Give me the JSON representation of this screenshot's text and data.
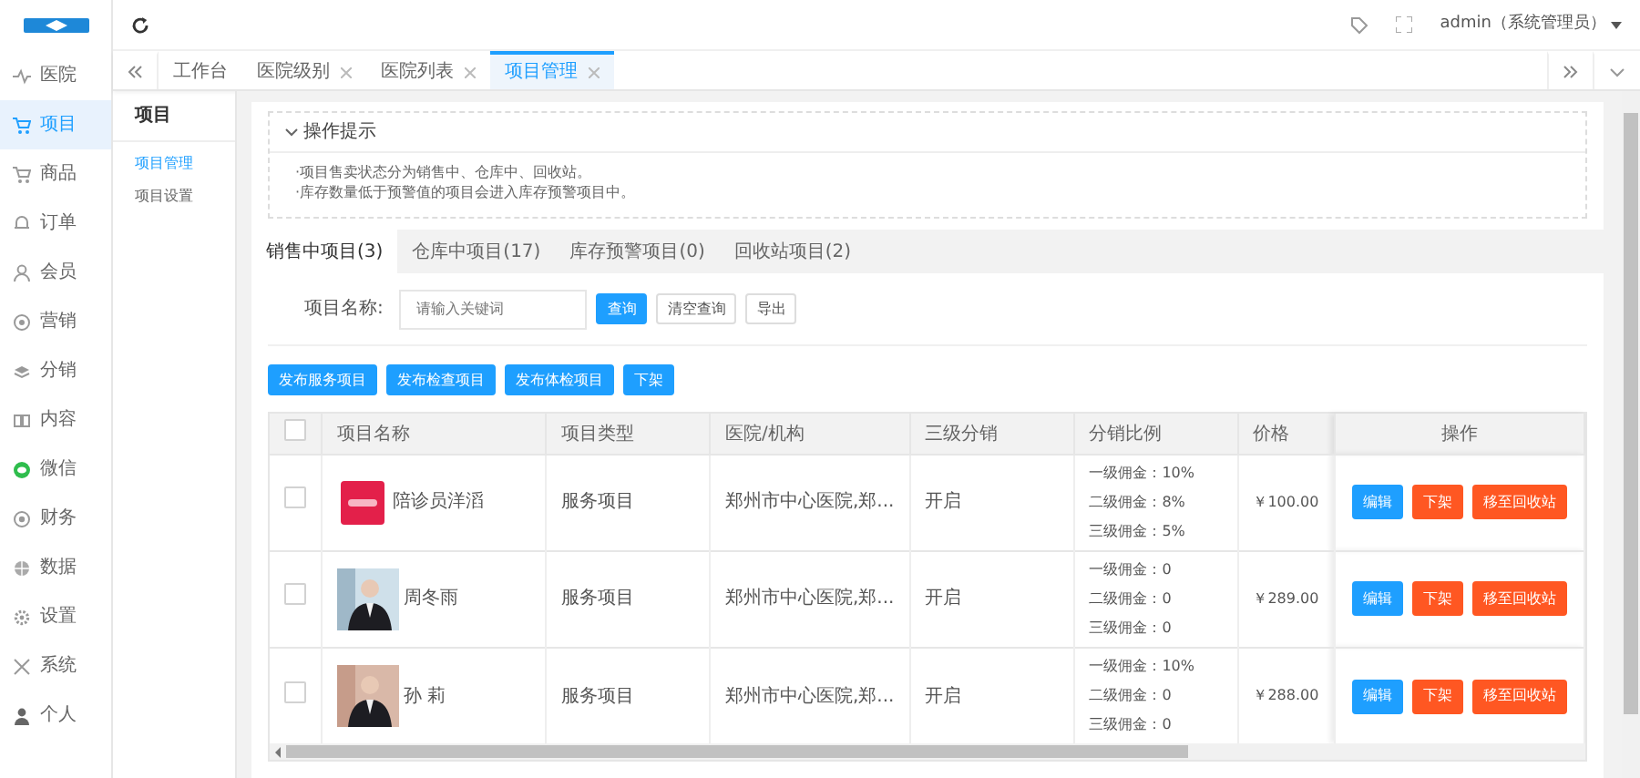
{
  "header": {
    "user": "admin（系统管理员）"
  },
  "sidebar": {
    "items": [
      {
        "label": "医院",
        "selected": false
      },
      {
        "label": "项目",
        "selected": true
      },
      {
        "label": "商品",
        "selected": false
      },
      {
        "label": "订单",
        "selected": false
      },
      {
        "label": "会员",
        "selected": false
      },
      {
        "label": "营销",
        "selected": false
      },
      {
        "label": "分销",
        "selected": false
      },
      {
        "label": "内容",
        "selected": false
      },
      {
        "label": "微信",
        "selected": false
      },
      {
        "label": "财务",
        "selected": false
      },
      {
        "label": "数据",
        "selected": false
      },
      {
        "label": "设置",
        "selected": false
      },
      {
        "label": "系统",
        "selected": false
      },
      {
        "label": "个人",
        "selected": false
      }
    ]
  },
  "page_tabs": [
    {
      "label": "工作台",
      "closable": false,
      "selected": false
    },
    {
      "label": "医院级别",
      "closable": true,
      "selected": false
    },
    {
      "label": "医院列表",
      "closable": true,
      "selected": false
    },
    {
      "label": "项目管理",
      "closable": true,
      "selected": true
    }
  ],
  "subnav": {
    "title": "项目",
    "items": [
      {
        "label": "项目管理",
        "selected": true
      },
      {
        "label": "项目设置",
        "selected": false
      }
    ]
  },
  "tips": {
    "title": "操作提示",
    "expanded": true,
    "lines": [
      "·项目售卖状态分为销售中、仓库中、回收站。",
      "·库存数量低于预警值的项目会进入库存预警项目中。"
    ]
  },
  "status_tabs": [
    {
      "label": "销售中项目(3)",
      "selected": true
    },
    {
      "label": "仓库中项目(17)",
      "selected": false
    },
    {
      "label": "库存预警项目(0)",
      "selected": false
    },
    {
      "label": "回收站项目(2)",
      "selected": false
    }
  ],
  "search": {
    "label": "项目名称:",
    "placeholder": "请输入关键词",
    "buttons": [
      {
        "label": "查询",
        "kind": "primary"
      },
      {
        "label": "清空查询",
        "kind": "plain"
      },
      {
        "label": "导出",
        "kind": "plain"
      }
    ]
  },
  "actions": [
    "发布服务项目",
    "发布检查项目",
    "发布体检项目",
    "下架"
  ],
  "table": {
    "select_all_checked": false,
    "columns": [
      "项目名称",
      "项目类型",
      "医院/机构",
      "三级分销",
      "分销比例",
      "价格",
      "操作"
    ],
    "rows": [
      {
        "checked": false,
        "thumb": {
          "kind": "picture"
        },
        "name": "陪诊员洋滔",
        "type": "服务项目",
        "hospital": "郑州市中心医院,郑...",
        "tier": "开启",
        "ratios": [
          "一级佣金：10%",
          "二级佣金：8%",
          "三级佣金：5%"
        ],
        "price": "￥100.00",
        "buttons": [
          {
            "label": "编辑",
            "kind": "primary"
          },
          {
            "label": "下架",
            "kind": "danger"
          },
          {
            "label": "移至回收站",
            "kind": "danger"
          }
        ]
      },
      {
        "checked": false,
        "thumb": {
          "kind": "picture"
        },
        "name": "周冬雨",
        "type": "服务项目",
        "hospital": "郑州市中心医院,郑...",
        "tier": "开启",
        "ratios": [
          "一级佣金：0",
          "二级佣金：0",
          "三级佣金：0"
        ],
        "price": "￥289.00",
        "buttons": [
          {
            "label": "编辑",
            "kind": "primary"
          },
          {
            "label": "下架",
            "kind": "danger"
          },
          {
            "label": "移至回收站",
            "kind": "danger"
          }
        ]
      },
      {
        "checked": false,
        "thumb": {
          "kind": "picture"
        },
        "name": "孙 莉",
        "type": "服务项目",
        "hospital": "郑州市中心医院,郑...",
        "tier": "开启",
        "ratios": [
          "一级佣金：10%",
          "二级佣金：0",
          "三级佣金：0"
        ],
        "price": "￥288.00",
        "buttons": [
          {
            "label": "编辑",
            "kind": "primary"
          },
          {
            "label": "下架",
            "kind": "danger"
          },
          {
            "label": "移至回收站",
            "kind": "danger"
          }
        ]
      }
    ]
  }
}
